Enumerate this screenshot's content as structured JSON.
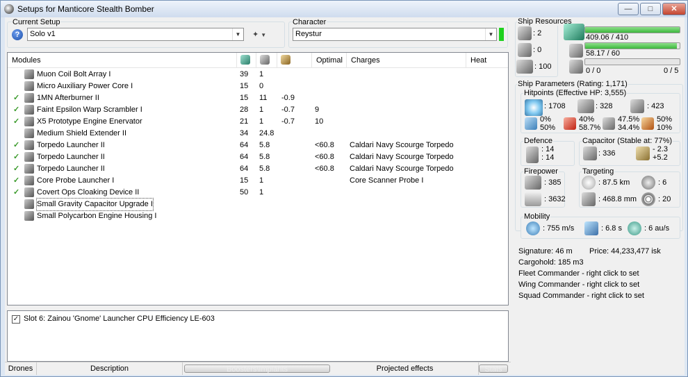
{
  "window": {
    "title": "Setups for Manticore Stealth Bomber"
  },
  "current_setup": {
    "label": "Current Setup",
    "value": "Solo v1"
  },
  "character": {
    "label": "Character",
    "value": "Reystur"
  },
  "modules": {
    "headers": [
      "Modules",
      "",
      "",
      "",
      "Optimal",
      "Charges",
      "Heat"
    ],
    "rows": [
      {
        "checked": false,
        "name": "Muon Coil Bolt Array I",
        "c1": "39",
        "c2": "1",
        "c3": "",
        "optimal": "",
        "charges": ""
      },
      {
        "checked": false,
        "name": "Micro Auxiliary Power Core I",
        "c1": "15",
        "c2": "0",
        "c3": "",
        "optimal": "",
        "charges": ""
      },
      {
        "checked": true,
        "name": "1MN Afterburner II",
        "c1": "15",
        "c2": "11",
        "c3": "-0.9",
        "optimal": "",
        "charges": ""
      },
      {
        "checked": true,
        "name": "Faint Epsilon Warp Scrambler I",
        "c1": "28",
        "c2": "1",
        "c3": "-0.7",
        "optimal": "9",
        "charges": ""
      },
      {
        "checked": true,
        "name": "X5 Prototype Engine Enervator",
        "c1": "21",
        "c2": "1",
        "c3": "-0.7",
        "optimal": "10",
        "charges": ""
      },
      {
        "checked": false,
        "name": "Medium Shield Extender II",
        "c1": "34",
        "c2": "24.8",
        "c3": "",
        "optimal": "",
        "charges": ""
      },
      {
        "checked": true,
        "name": "Torpedo Launcher II",
        "c1": "64",
        "c2": "5.8",
        "c3": "",
        "optimal": "<60.8",
        "charges": "Caldari Navy Scourge Torpedo"
      },
      {
        "checked": true,
        "name": "Torpedo Launcher II",
        "c1": "64",
        "c2": "5.8",
        "c3": "",
        "optimal": "<60.8",
        "charges": "Caldari Navy Scourge Torpedo"
      },
      {
        "checked": true,
        "name": "Torpedo Launcher II",
        "c1": "64",
        "c2": "5.8",
        "c3": "",
        "optimal": "<60.8",
        "charges": "Caldari Navy Scourge Torpedo"
      },
      {
        "checked": true,
        "name": "Core Probe Launcher I",
        "c1": "15",
        "c2": "1",
        "c3": "",
        "optimal": "",
        "charges": "Core Scanner Probe I"
      },
      {
        "checked": true,
        "name": "Covert Ops Cloaking Device II",
        "c1": "50",
        "c2": "1",
        "c3": "",
        "optimal": "",
        "charges": ""
      },
      {
        "checked": false,
        "name": "Small Gravity Capacitor Upgrade I",
        "c1": "",
        "c2": "",
        "c3": "",
        "optimal": "",
        "charges": ""
      },
      {
        "checked": false,
        "name": "Small Polycarbon Engine Housing I",
        "c1": "",
        "c2": "",
        "c3": "",
        "optimal": "",
        "charges": ""
      }
    ]
  },
  "description": {
    "checked": true,
    "text": "Slot 6: Zainou 'Gnome' Launcher CPU Efficiency LE-603"
  },
  "statusbar": {
    "drones": "Drones",
    "description": "Description",
    "boosters": "Boosters\\Implants",
    "projected": "Projected effects",
    "stats": "Stats"
  },
  "ship_resources": {
    "label": "Ship Resources",
    "turrets": ": 2",
    "launchers": ": 0",
    "drones": ": 100",
    "cpu": "409.06 / 410",
    "cpu_fraction": 0.998,
    "power": "58.17 / 60",
    "power_fraction": 0.97,
    "calibration": "0 / 0",
    "calibration_fraction": 0,
    "rigs": "0 / 5"
  },
  "ship_parameters": {
    "label": "Ship Parameters (Rating: 1,171)",
    "hitpoints_label": "Hitpoints (Effective HP: 3,555)",
    "shield_hp": ": 1708",
    "armor_hp": ": 328",
    "hull_hp": ": 423",
    "res_em_a": "0%",
    "res_em_b": "50%",
    "res_th_a": "40%",
    "res_th_b": "58.7%",
    "res_kin_a": "47.5%",
    "res_kin_b": "34.4%",
    "res_exp_a": "50%",
    "res_exp_b": "10%",
    "defence_label": "Defence",
    "def_a": ": 14",
    "def_b": ": 14",
    "capacitor_label": "Capacitor (Stable at: 77%)",
    "cap_amount": ": 336",
    "cap_a": "- 2.3",
    "cap_b": "+5.2",
    "firepower_label": "Firepower",
    "fp_a": ": 385",
    "fp_b": ": 3632",
    "targeting_label": "Targeting",
    "range": ": 87.5 km",
    "targets": ": 6",
    "scan": ": 468.8 mm",
    "sensor": ": 20",
    "mobility_label": "Mobility",
    "speed": ": 755 m/s",
    "align": ": 6.8 s",
    "warp": ": 6 au/s",
    "signature": "Signature: 46 m",
    "price": "Price: 44,233,477 isk",
    "cargohold": "Cargohold: 185 m3",
    "fleet": "Fleet Commander - right click to set",
    "wing": "Wing Commander - right click to set",
    "squad": "Squad Commander - right click to set"
  }
}
